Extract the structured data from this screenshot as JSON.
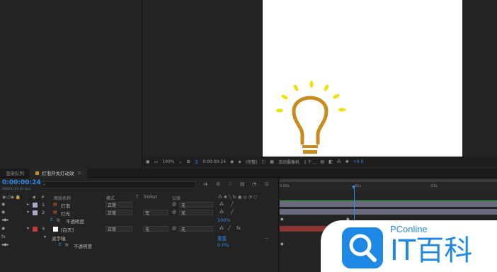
{
  "viewer_toolbar": {
    "zoom": "100%",
    "timecode": "0:00:00:24",
    "resolution": "(完整)",
    "camera": "活动摄像机",
    "views": "1 个...",
    "exposure": "+0.0"
  },
  "tabs": [
    {
      "label": "渲染队列"
    },
    {
      "label": "灯泡开关灯动效"
    }
  ],
  "timeline": {
    "timecode": "0:00:00:24",
    "frame_info": "00024 (25.00 fps)",
    "search_placeholder": "",
    "headers": {
      "num": "#",
      "layer_name": "图层名称",
      "mode": "模式",
      "t": "T",
      "trkmat": "TrkMat",
      "parent": "父级"
    },
    "ruler_labels": [
      "0:00s",
      "01s",
      "02s"
    ],
    "layers": [
      {
        "num": "1",
        "name": "灯泡",
        "mode": "正常",
        "trkmat": "",
        "parent": "无",
        "color": "#a8a8c8"
      },
      {
        "num": "2",
        "name": "灯光",
        "mode": "正常",
        "trkmat": "无",
        "parent": "无",
        "color": "#a8a8c8"
      },
      {
        "num": "3",
        "name": "[白天]",
        "mode": "正常",
        "trkmat": "无",
        "parent": "无",
        "color": "#c43a3a"
      }
    ],
    "sub_rows": [
      {
        "label": "不透明度",
        "value": "100%"
      },
      {
        "label": "滤字轴",
        "value": "重置"
      },
      {
        "label": "不透明度",
        "value": "0.0%"
      }
    ]
  },
  "watermark": {
    "brand": "PConline",
    "title": "IT百科"
  },
  "colors": {
    "accent": "#2d8ceb",
    "bulb": "#c98a1e",
    "rays": "#f2e000"
  }
}
